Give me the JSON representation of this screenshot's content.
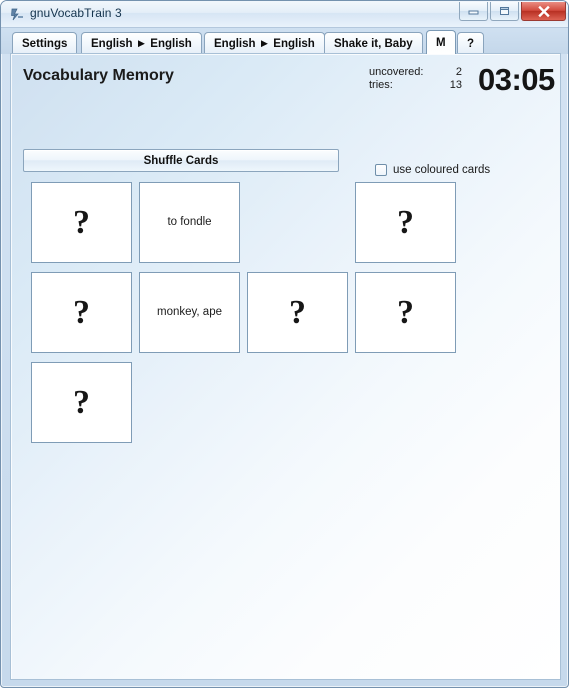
{
  "window": {
    "title": "gnuVocabTrain 3",
    "icon": "app-icon",
    "controls": {
      "minimize_label": "–",
      "maximize_label": "❐",
      "close_label": "✕"
    }
  },
  "tabs": [
    {
      "label": "Settings",
      "active": false
    },
    {
      "label": "English ► English",
      "active": false
    },
    {
      "label": "English ► English",
      "active": false
    },
    {
      "label": "Shake it, Baby",
      "active": false
    },
    {
      "label": "M",
      "active": true
    },
    {
      "label": "?",
      "active": false
    }
  ],
  "page": {
    "title": "Vocabulary Memory"
  },
  "stats": {
    "uncovered_label": "uncovered:",
    "uncovered_value": "2",
    "tries_label": "tries:",
    "tries_value": "13",
    "timer": "03:05"
  },
  "toolbar": {
    "shuffle_label": "Shuffle Cards",
    "coloured_cards_label": "use coloured cards",
    "coloured_cards_checked": false
  },
  "cards": {
    "face_down_glyph": "?",
    "rows": [
      [
        {
          "state": "face-down",
          "text": "?"
        },
        {
          "state": "face-up",
          "text": "to fondle"
        },
        {
          "state": "empty",
          "text": ""
        },
        {
          "state": "face-down",
          "text": "?"
        }
      ],
      [
        {
          "state": "face-down",
          "text": "?"
        },
        {
          "state": "face-up",
          "text": "monkey, ape"
        },
        {
          "state": "face-down",
          "text": "?"
        },
        {
          "state": "face-down",
          "text": "?"
        }
      ],
      [
        {
          "state": "face-down",
          "text": "?"
        }
      ]
    ]
  },
  "colors": {
    "panel_accent": "#cfe0f0",
    "title_text": "#14334d",
    "close_button": "#c0392b",
    "card_border": "#7f9cb6"
  }
}
